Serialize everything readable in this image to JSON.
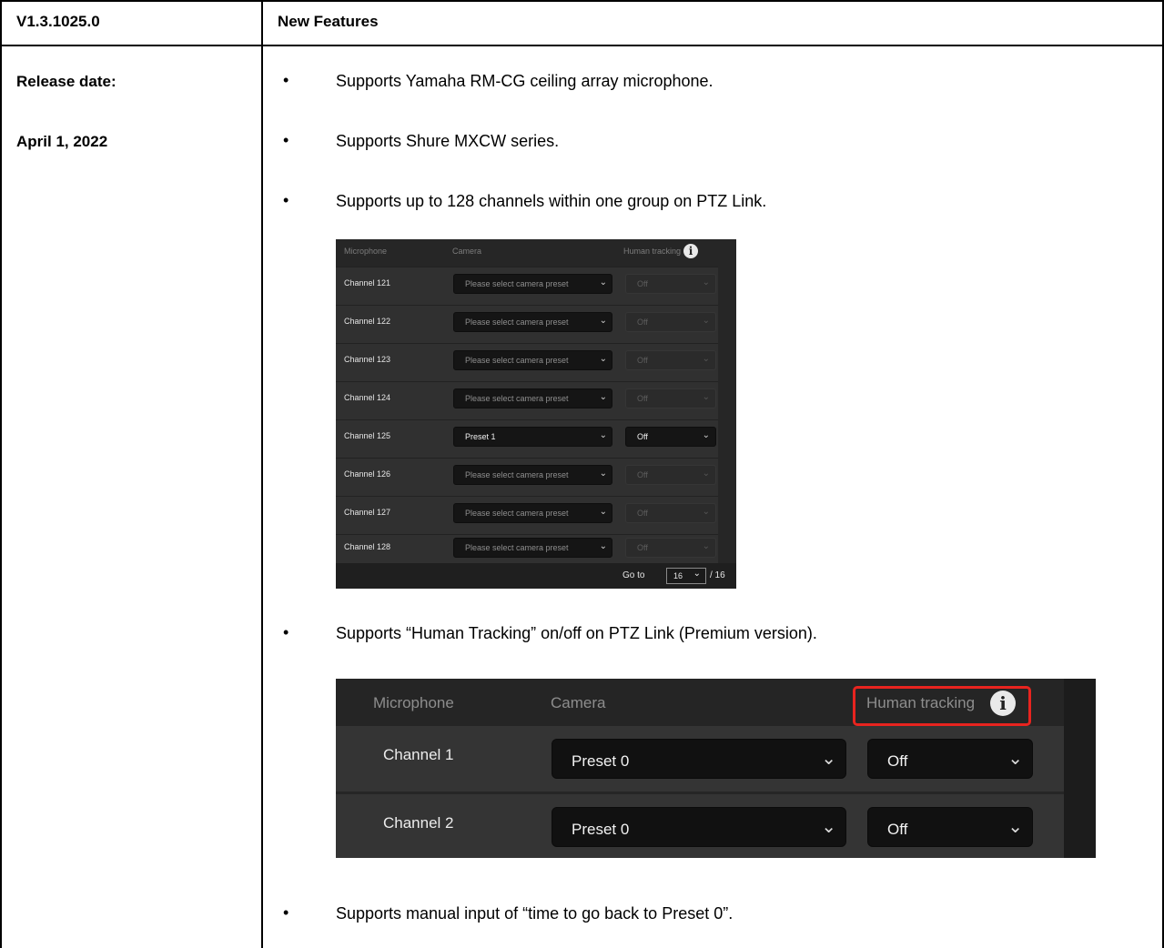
{
  "left_column": {
    "version": "V1.3.1025.0",
    "release_label": "Release date:",
    "release_date": "April 1, 2022"
  },
  "right_column": {
    "heading": "New Features",
    "bullet_symbol": "•",
    "features": [
      "Supports Yamaha RM-CG ceiling array microphone.",
      "Supports Shure MXCW series.",
      "Supports up to 128 channels within one group on PTZ Link.",
      "Supports “Human Tracking” on/off on PTZ Link (Premium version).",
      "Supports manual input of “time to go back to Preset 0”."
    ]
  },
  "screenshot_small": {
    "headers": {
      "microphone": "Microphone",
      "camera": "Camera",
      "tracking": "Human tracking"
    },
    "rows": [
      {
        "channel": "Channel 121",
        "camera": "Please select camera preset",
        "tracking": "Off",
        "active": false
      },
      {
        "channel": "Channel 122",
        "camera": "Please select camera preset",
        "tracking": "Off",
        "active": false
      },
      {
        "channel": "Channel 123",
        "camera": "Please select camera preset",
        "tracking": "Off",
        "active": false
      },
      {
        "channel": "Channel 124",
        "camera": "Please select camera preset",
        "tracking": "Off",
        "active": false
      },
      {
        "channel": "Channel 125",
        "camera": "Preset 1",
        "tracking": "Off",
        "active": true
      },
      {
        "channel": "Channel 126",
        "camera": "Please select camera preset",
        "tracking": "Off",
        "active": false
      },
      {
        "channel": "Channel 127",
        "camera": "Please select camera preset",
        "tracking": "Off",
        "active": false
      },
      {
        "channel": "Channel 128",
        "camera": "Please select camera preset",
        "tracking": "Off",
        "active": false
      }
    ],
    "pagination": {
      "goto_label": "Go to",
      "current_page": "16",
      "total_label": "/ 16"
    }
  },
  "screenshot_large": {
    "headers": {
      "microphone": "Microphone",
      "camera": "Camera",
      "tracking": "Human tracking"
    },
    "highlight_color": "#e8241f",
    "rows": [
      {
        "channel": "Channel 1",
        "camera": "Preset 0",
        "tracking": "Off"
      },
      {
        "channel": "Channel 2",
        "camera": "Preset 0",
        "tracking": "Off"
      }
    ]
  }
}
